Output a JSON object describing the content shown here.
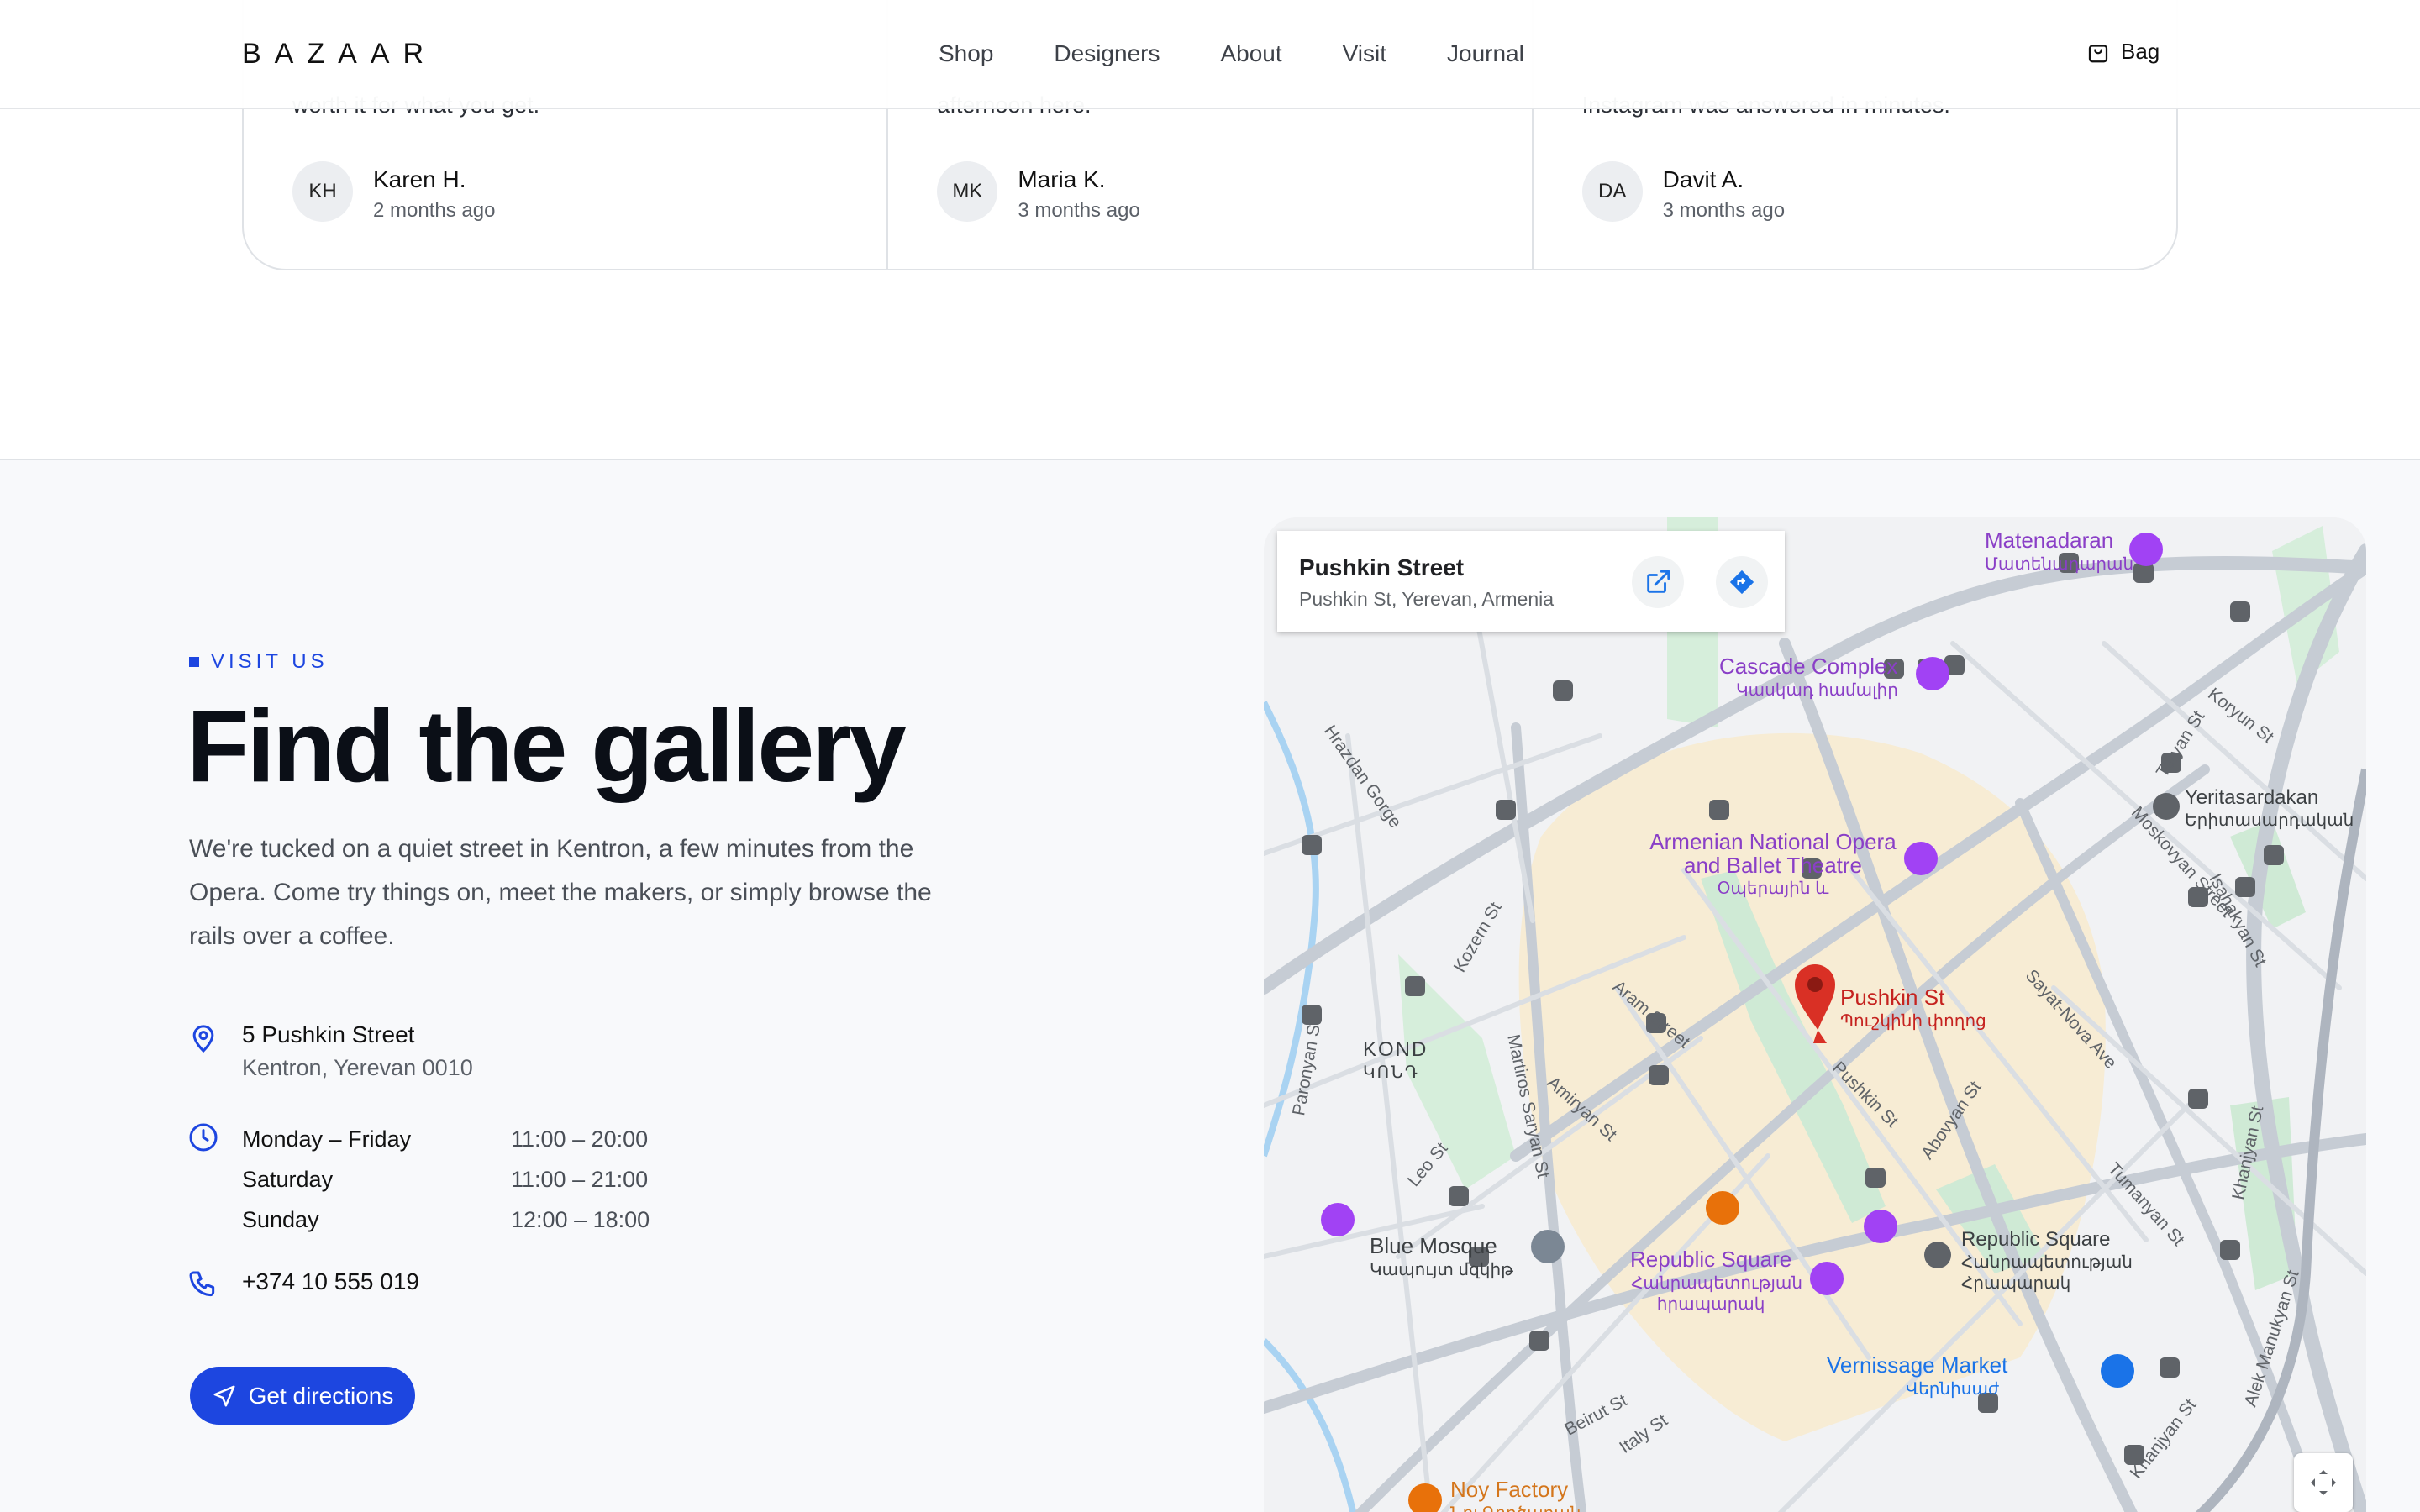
{
  "header": {
    "logo": "BAZAAR",
    "nav": [
      "Shop",
      "Designers",
      "About",
      "Visit",
      "Journal"
    ],
    "bag_label": "Bag"
  },
  "reviews": [
    {
      "text_fragment": "worth it for what you get.",
      "initials": "KH",
      "name": "Karen H.",
      "date": "2 months ago"
    },
    {
      "text_fragment": "afternoon here.",
      "initials": "MK",
      "name": "Maria K.",
      "date": "3 months ago"
    },
    {
      "text_fragment": "Instagram was answered in minutes.",
      "initials": "DA",
      "name": "Davit A.",
      "date": "3 months ago"
    }
  ],
  "visit": {
    "eyebrow": "VISIT US",
    "title": "Find the gallery",
    "lead": "We're tucked on a quiet street in Kentron, a few minutes from the Opera. Come try things on, meet the makers, or simply browse the rails over a coffee.",
    "address_line1": "5 Pushkin Street",
    "address_line2": "Kentron, Yerevan 0010",
    "hours": [
      {
        "day": "Monday – Friday",
        "time": "11:00 – 20:00"
      },
      {
        "day": "Saturday",
        "time": "11:00 – 21:00"
      },
      {
        "day": "Sunday",
        "time": "12:00 – 18:00"
      }
    ],
    "phone": "+374 10 555 019",
    "directions_label": "Get directions",
    "accent_color": "#1d46e0"
  },
  "map": {
    "card_title": "Pushkin Street",
    "card_subtitle": "Pushkin St, Yerevan, Armenia",
    "pin_label": "Pushkin St",
    "pin_label_local": "Պուշկինի փողոց",
    "places": [
      {
        "name": "Matenadaran",
        "local": "Մատենադարան"
      },
      {
        "name": "Cascade Complex",
        "local": "Կասկադ համալիր"
      },
      {
        "name": "Armenian National Opera and Ballet Theatre",
        "local": "Օպերային և"
      },
      {
        "name": "Yeritasardakan",
        "local": "Երիտասարդական"
      },
      {
        "name": "KOND",
        "local": "ԿՈՆԴ"
      },
      {
        "name": "Blue Mosque",
        "local": "Կապույտ մզկիթ"
      },
      {
        "name": "Republic Square",
        "local": "Հանրապետության հրապարակ"
      },
      {
        "name": "Republic Square",
        "local": "Հանրապետության Հրապարակ"
      },
      {
        "name": "Vernissage Market",
        "local": "Վերնիսաժ"
      },
      {
        "name": "Noy Factory",
        "local": "Նոյ Գործարան"
      }
    ],
    "streets": [
      "Koryun St",
      "Moskovyan Street",
      "Teryan St",
      "Isahakyan St",
      "Sayat-Nova Ave",
      "Tumanyan St",
      "Khanjyan St",
      "Abovyan St",
      "Pushkin St",
      "Aram Street",
      "Amiryan St",
      "Martiros Saryan St",
      "Kozern St",
      "Paronyan St",
      "Leo St",
      "Beirut St",
      "Italy St",
      "Alek Manukyan St",
      "Hrazdan Gorge",
      "Khanjyan St"
    ]
  }
}
